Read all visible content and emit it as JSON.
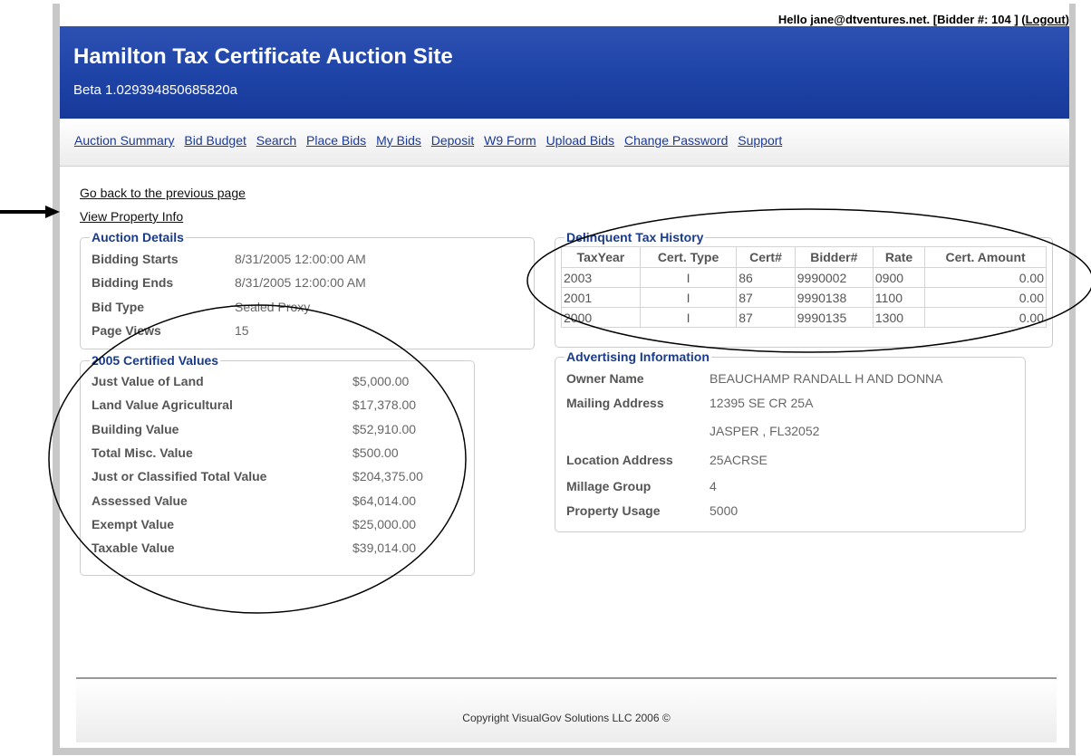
{
  "header": {
    "greeting": "Hello jane@dtventures.net. [Bidder #: 104 ] (",
    "logout": "Logout",
    "greeting_end": ")",
    "site_title": "Hamilton Tax Certificate Auction Site",
    "version": "Beta 1.029394850685820a"
  },
  "nav": [
    "Auction Summary",
    "Bid Budget",
    "Search",
    "Place Bids",
    "My Bids",
    "Deposit",
    "W9 Form",
    "Upload Bids",
    "Change Password",
    "Support"
  ],
  "links": {
    "back": "Go back to the previous page",
    "view_property": "View Property Info"
  },
  "auction_details": {
    "legend": "Auction Details",
    "rows": [
      {
        "label": "Bidding Starts",
        "value": "8/31/2005 12:00:00 AM"
      },
      {
        "label": "Bidding Ends",
        "value": "8/31/2005 12:00:00 AM"
      },
      {
        "label": "Bid Type",
        "value": "Sealed Proxy"
      },
      {
        "label": "Page Views",
        "value": "15"
      }
    ]
  },
  "certified_values": {
    "legend": "2005 Certified Values",
    "rows": [
      {
        "label": "Just Value of Land",
        "value": "$5,000.00"
      },
      {
        "label": "Land Value Agricultural",
        "value": "$17,378.00"
      },
      {
        "label": "Building Value",
        "value": "$52,910.00"
      },
      {
        "label": "Total Misc. Value",
        "value": "$500.00"
      },
      {
        "label": "Just or Classified Total Value",
        "value": "$204,375.00"
      },
      {
        "label": "Assessed Value",
        "value": "$64,014.00"
      },
      {
        "label": "Exempt Value",
        "value": "$25,000.00"
      },
      {
        "label": "Taxable Value",
        "value": "$39,014.00"
      }
    ]
  },
  "tax_history": {
    "legend": "Delinquent Tax History",
    "columns": [
      "TaxYear",
      "Cert. Type",
      "Cert#",
      "Bidder#",
      "Rate",
      "Cert. Amount"
    ],
    "rows": [
      [
        "2003",
        "I",
        "86",
        "9990002",
        "0900",
        "0.00"
      ],
      [
        "2001",
        "I",
        "87",
        "9990138",
        "1100",
        "0.00"
      ],
      [
        "2000",
        "I",
        "87",
        "9990135",
        "1300",
        "0.00"
      ]
    ]
  },
  "advertising": {
    "legend": "Advertising Information",
    "rows": [
      {
        "label": "Owner Name",
        "value": "BEAUCHAMP RANDALL H AND DONNA"
      },
      {
        "label": "Mailing Address",
        "value": "12395 SE CR 25A"
      },
      {
        "label": "",
        "value": "JASPER , FL32052"
      },
      {
        "label": "Location Address",
        "value": "25ACRSE"
      },
      {
        "label": "Millage Group",
        "value": "4"
      },
      {
        "label": "Property Usage",
        "value": "5000"
      }
    ]
  },
  "footer": {
    "copyright": "Copyright VisualGov Solutions LLC 2006 ©"
  },
  "colors": {
    "banner": "#1e43a6",
    "legend": "#1a3a8a",
    "nav_link": "#1a3a9a"
  }
}
